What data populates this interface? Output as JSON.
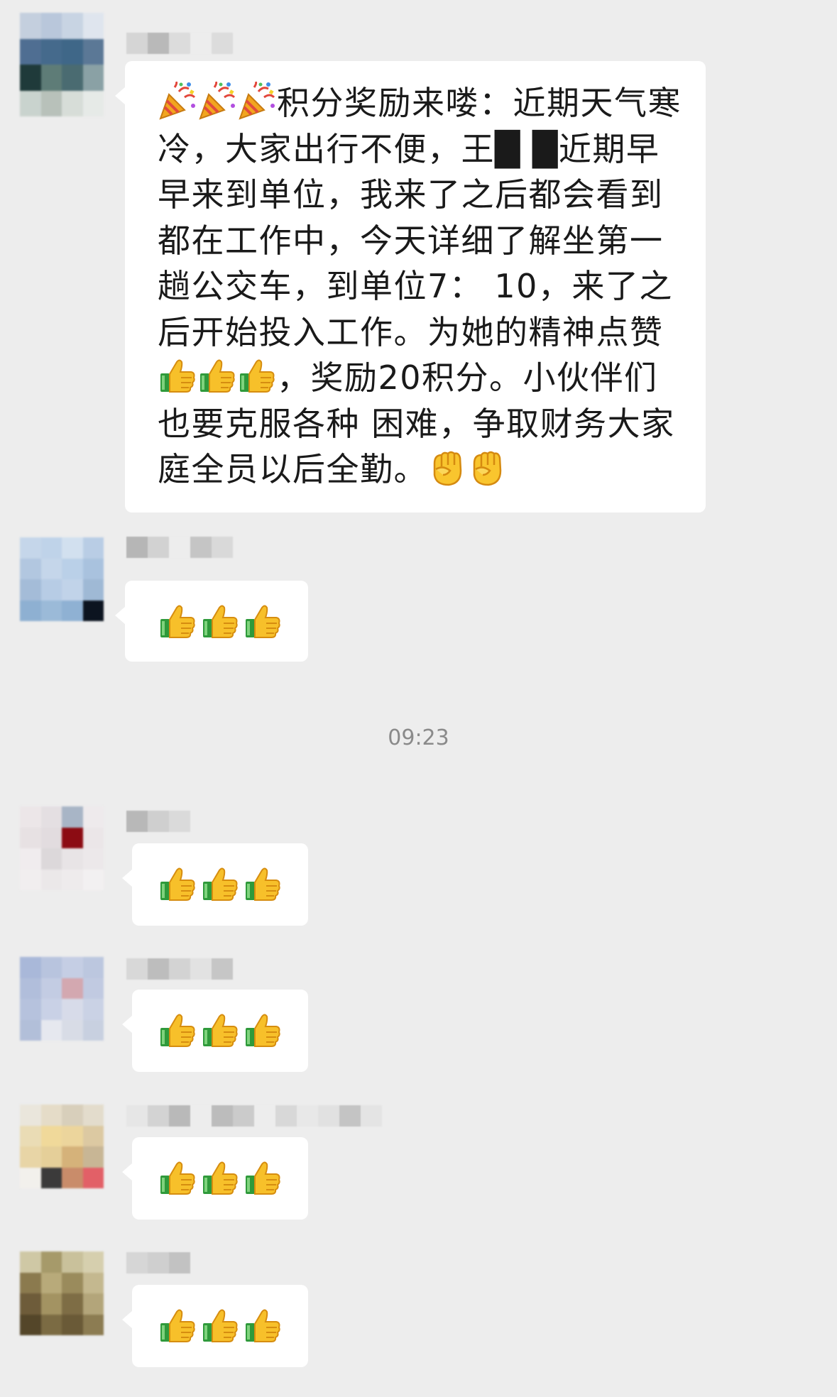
{
  "chat": {
    "timestamp": "09:23",
    "messages": [
      {
        "text": "积分奖励来喽：近期天气寒冷，大家出行不便，王█ █近期早早来到单位，我来了之后都会看到都在工作中，今天详细了解坐第一趟公交车，到单位7： 10，来了之后开始投入工作。为她的精神点赞，奖励20积分。小伙伴们也要克服各种 困难，争取财务大家庭全员以后全勤。",
        "leading_emoji": [
          "party-popper-icon",
          "party-popper-icon",
          "party-popper-icon"
        ],
        "inline_emoji": [
          "thumbs-up-icon",
          "thumbs-up-icon",
          "thumbs-up-icon"
        ],
        "trailing_emoji": [
          "raised-fist-icon",
          "raised-fist-icon"
        ]
      },
      {
        "emoji": [
          "thumbs-up-icon",
          "thumbs-up-icon",
          "thumbs-up-icon"
        ]
      },
      {
        "emoji": [
          "thumbs-up-icon",
          "thumbs-up-icon",
          "thumbs-up-icon"
        ]
      },
      {
        "emoji": [
          "thumbs-up-icon",
          "thumbs-up-icon",
          "thumbs-up-icon"
        ]
      },
      {
        "emoji": [
          "thumbs-up-icon",
          "thumbs-up-icon",
          "thumbs-up-icon"
        ]
      },
      {
        "emoji": [
          "thumbs-up-icon",
          "thumbs-up-icon",
          "thumbs-up-icon"
        ]
      }
    ]
  },
  "colors": {
    "background": "#ededed",
    "bubble": "#ffffff",
    "text": "#1a1a1a",
    "timestamp": "#8a8a8a"
  }
}
